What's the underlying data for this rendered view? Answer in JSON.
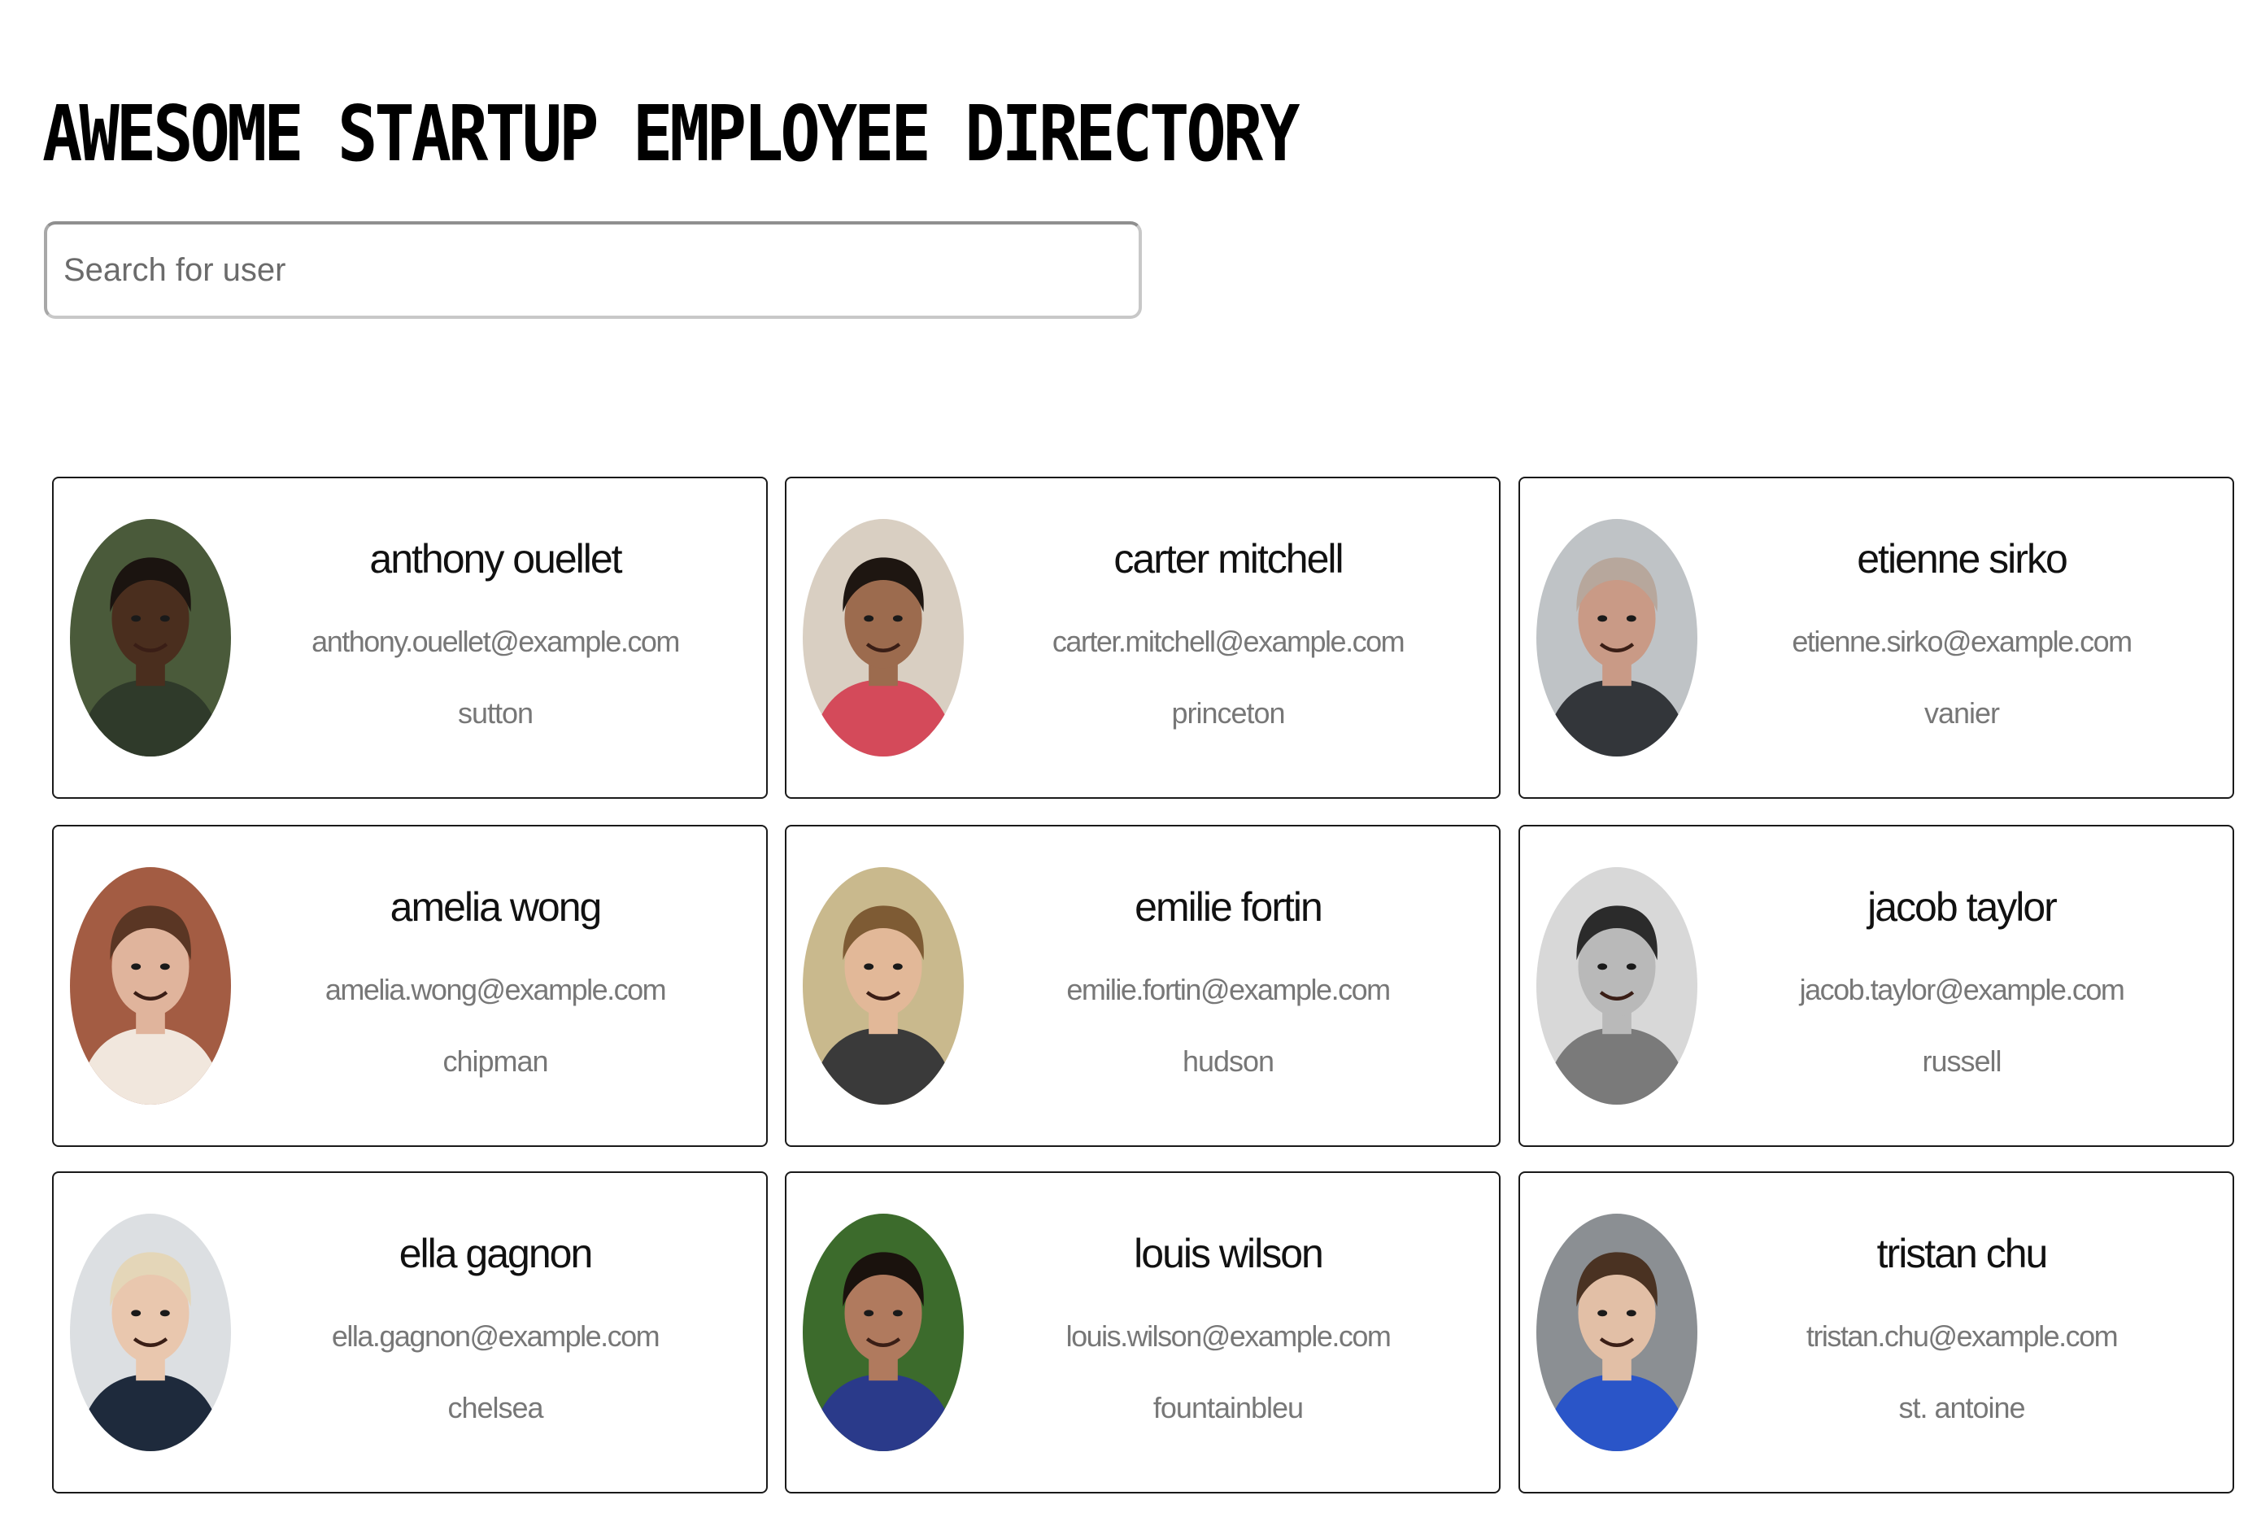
{
  "header": {
    "title": "AWESOME STARTUP EMPLOYEE DIRECTORY"
  },
  "search": {
    "placeholder": "Search for user",
    "value": ""
  },
  "employees": [
    {
      "name": "anthony ouellet",
      "email": "anthony.ouellet@example.com",
      "city": "sutton",
      "photo": "photo-of-smiling-man",
      "bg": "#4a5a3a",
      "skin": "#4a2e1e",
      "hair": "#1b1410",
      "shirt": "#2f3a2a"
    },
    {
      "name": "carter mitchell",
      "email": "carter.mitchell@example.com",
      "city": "princeton",
      "photo": "photo-of-smiling-man",
      "bg": "#d9cfc2",
      "skin": "#9c6b4e",
      "hair": "#1e1611",
      "shirt": "#d44a5a"
    },
    {
      "name": "etienne sirko",
      "email": "etienne.sirko@example.com",
      "city": "vanier",
      "photo": "photo-of-man-with-glasses",
      "bg": "#bfc3c6",
      "skin": "#c99a86",
      "hair": "#b7a79c",
      "shirt": "#33363a"
    },
    {
      "name": "amelia wong",
      "email": "amelia.wong@example.com",
      "city": "chipman",
      "photo": "photo-of-smiling-woman",
      "bg": "#a35c43",
      "skin": "#e0b49c",
      "hair": "#5a3624",
      "shirt": "#f1e7dd"
    },
    {
      "name": "emilie fortin",
      "email": "emilie.fortin@example.com",
      "city": "hudson",
      "photo": "photo-of-smiling-woman",
      "bg": "#c9b98d",
      "skin": "#e2b898",
      "hair": "#7e5b34",
      "shirt": "#3a3a3a"
    },
    {
      "name": "jacob taylor",
      "email": "jacob.taylor@example.com",
      "city": "russell",
      "photo": "photo-of-man-black-and-white",
      "bg": "#d8d8d8",
      "skin": "#b9b9b9",
      "hair": "#2b2b2b",
      "shirt": "#7a7a7a"
    },
    {
      "name": "ella gagnon",
      "email": "ella.gagnon@example.com",
      "city": "chelsea",
      "photo": "photo-of-smiling-woman",
      "bg": "#dcdfe2",
      "skin": "#e9c7ae",
      "hair": "#e4d6b8",
      "shirt": "#1e2a3c"
    },
    {
      "name": "louis wilson",
      "email": "louis.wilson@example.com",
      "city": "fountainbleu",
      "photo": "photo-of-man",
      "bg": "#3c6b2c",
      "skin": "#b07a5e",
      "hair": "#1a120d",
      "shirt": "#2a3a8a"
    },
    {
      "name": "tristan chu",
      "email": "tristan.chu@example.com",
      "city": "st. antoine",
      "photo": "photo-of-young-man",
      "bg": "#8b8f93",
      "skin": "#e2bfa6",
      "hair": "#4a3222",
      "shirt": "#2a55c8"
    }
  ]
}
